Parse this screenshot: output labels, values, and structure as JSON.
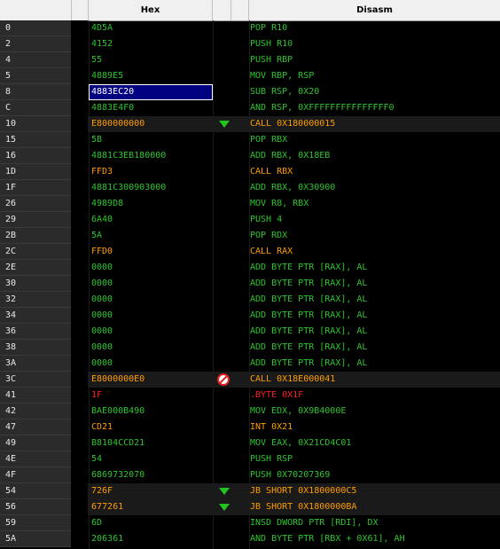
{
  "header": {
    "hex_label": "Hex",
    "disasm_label": "Disasm"
  },
  "rows": [
    {
      "off": "0",
      "hex": "4D5A",
      "dis": "POP R10",
      "kind": "g"
    },
    {
      "off": "2",
      "hex": "4152",
      "dis": "PUSH R10",
      "kind": "g"
    },
    {
      "off": "4",
      "hex": "55",
      "dis": "PUSH RBP",
      "kind": "g"
    },
    {
      "off": "5",
      "hex": "4889E5",
      "dis": "MOV RBP, RSP",
      "kind": "g"
    },
    {
      "off": "8",
      "hex": "4883EC20",
      "dis": "SUB RSP, 0X20",
      "kind": "g",
      "selected": true
    },
    {
      "off": "C",
      "hex": "4883E4F0",
      "dis": "AND RSP, 0XFFFFFFFFFFFFFFF0",
      "kind": "g"
    },
    {
      "off": "10",
      "hex": "E800000000",
      "dis": "CALL 0X180000015",
      "kind": "o",
      "mark": "down-arrow",
      "jump": true
    },
    {
      "off": "15",
      "hex": "5B",
      "dis": "POP RBX",
      "kind": "g"
    },
    {
      "off": "16",
      "hex": "4881C3EB180000",
      "dis": "ADD RBX, 0X18EB",
      "kind": "g"
    },
    {
      "off": "1D",
      "hex": "FFD3",
      "dis": "CALL RBX",
      "kind": "o"
    },
    {
      "off": "1F",
      "hex": "4881C300903000",
      "dis": "ADD RBX, 0X30900",
      "kind": "g"
    },
    {
      "off": "26",
      "hex": "4989D8",
      "dis": "MOV R8, RBX",
      "kind": "g"
    },
    {
      "off": "29",
      "hex": "6A40",
      "dis": "PUSH 4",
      "kind": "g"
    },
    {
      "off": "2B",
      "hex": "5A",
      "dis": "POP RDX",
      "kind": "g"
    },
    {
      "off": "2C",
      "hex": "FFD0",
      "dis": "CALL RAX",
      "kind": "o"
    },
    {
      "off": "2E",
      "hex": "0000",
      "dis": "ADD BYTE PTR [RAX], AL",
      "kind": "g"
    },
    {
      "off": "30",
      "hex": "0000",
      "dis": "ADD BYTE PTR [RAX], AL",
      "kind": "g"
    },
    {
      "off": "32",
      "hex": "0000",
      "dis": "ADD BYTE PTR [RAX], AL",
      "kind": "g"
    },
    {
      "off": "34",
      "hex": "0000",
      "dis": "ADD BYTE PTR [RAX], AL",
      "kind": "g"
    },
    {
      "off": "36",
      "hex": "0000",
      "dis": "ADD BYTE PTR [RAX], AL",
      "kind": "g"
    },
    {
      "off": "38",
      "hex": "0000",
      "dis": "ADD BYTE PTR [RAX], AL",
      "kind": "g"
    },
    {
      "off": "3A",
      "hex": "0000",
      "dis": "ADD BYTE PTR [RAX], AL",
      "kind": "g"
    },
    {
      "off": "3C",
      "hex": "E8000000E0",
      "dis": "CALL 0X18E000041",
      "kind": "o",
      "mark": "invalid",
      "jump": true
    },
    {
      "off": "41",
      "hex": "1F",
      "dis": ".BYTE 0X1F",
      "kind": "r"
    },
    {
      "off": "42",
      "hex": "BAE000B490",
      "dis": "MOV EDX, 0X9B4000E",
      "kind": "g"
    },
    {
      "off": "47",
      "hex": "CD21",
      "dis": "INT 0X21",
      "kind": "o"
    },
    {
      "off": "49",
      "hex": "B8104CCD21",
      "dis": "MOV EAX, 0X21CD4C01",
      "kind": "g"
    },
    {
      "off": "4E",
      "hex": "54",
      "dis": "PUSH RSP",
      "kind": "g"
    },
    {
      "off": "4F",
      "hex": "6869732070",
      "dis": "PUSH 0X70207369",
      "kind": "g"
    },
    {
      "off": "54",
      "hex": "726F",
      "dis": "JB SHORT 0X1800000C5",
      "kind": "o",
      "mark": "down-arrow",
      "jump": true
    },
    {
      "off": "56",
      "hex": "677261",
      "dis": "JB SHORT 0X1800000BA",
      "kind": "o",
      "mark": "down-arrow",
      "jump": true
    },
    {
      "off": "59",
      "hex": "6D",
      "dis": "INSD DWORD PTR [RDI], DX",
      "kind": "g"
    },
    {
      "off": "5A",
      "hex": "206361",
      "dis": "AND BYTE PTR [RBX + 0X61], AH",
      "kind": "g"
    }
  ]
}
